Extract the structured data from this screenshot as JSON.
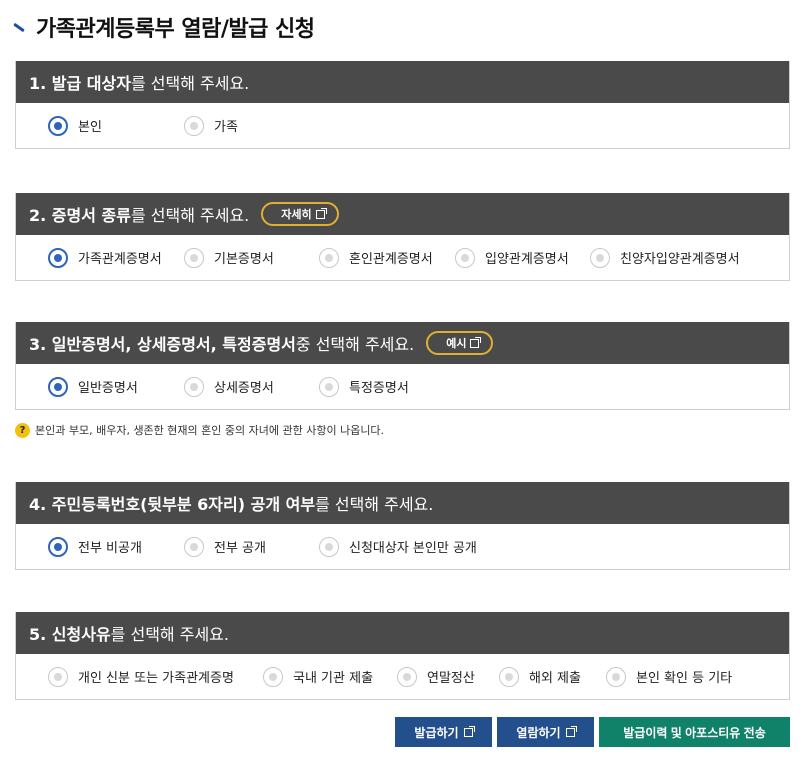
{
  "page": {
    "title": "가족관계등록부 열람/발급 신청"
  },
  "sections": [
    {
      "head_strong": "1. 발급 대상자",
      "head_rest": "를 선택해 주세요.",
      "options": [
        {
          "label": "본인",
          "checked": true
        },
        {
          "label": "가족",
          "checked": false
        }
      ]
    },
    {
      "head_strong": "2. 증명서 종류",
      "head_rest": "를 선택해 주세요.",
      "pill": "자세히",
      "options": [
        {
          "label": "가족관계증명서",
          "checked": true
        },
        {
          "label": "기본증명서",
          "checked": false
        },
        {
          "label": "혼인관계증명서",
          "checked": false
        },
        {
          "label": "입양관계증명서",
          "checked": false
        },
        {
          "label": "친양자입양관계증명서",
          "checked": false
        }
      ]
    },
    {
      "head_strong": "3. 일반증명서, 상세증명서, 특정증명서",
      "head_rest": " 중 선택해 주세요.",
      "pill": "예시",
      "options": [
        {
          "label": "일반증명서",
          "checked": true
        },
        {
          "label": "상세증명서",
          "checked": false
        },
        {
          "label": "특정증명서",
          "checked": false
        }
      ]
    },
    {
      "head_strong": "4. 주민등록번호(뒷부분 6자리) 공개 여부",
      "head_rest": "를 선택해 주세요.",
      "options": [
        {
          "label": "전부 비공개",
          "checked": true
        },
        {
          "label": "전부 공개",
          "checked": false
        },
        {
          "label": "신청대상자 본인만 공개",
          "checked": false
        }
      ]
    },
    {
      "head_strong": "5. 신청사유",
      "head_rest": "를 선택해 주세요.",
      "options": [
        {
          "label": "개인 신분 또는 가족관계증명",
          "checked": false
        },
        {
          "label": "국내 기관 제출",
          "checked": false
        },
        {
          "label": "연말정산",
          "checked": false
        },
        {
          "label": "해외 제출",
          "checked": false
        },
        {
          "label": "본인 확인 등 기타",
          "checked": false
        }
      ]
    }
  ],
  "note": {
    "icon": "?",
    "text": "본인과 부모, 배우자, 생존한 현재의 혼인 중의 자녀에 관한 사항이 나옵니다."
  },
  "buttons": {
    "issue": "발급하기",
    "view": "열람하기",
    "transmit": "발급이력 및 아포스티유 전송"
  },
  "colors": {
    "header_bg": "#4a4a4a",
    "radio_checked": "#2f64b8",
    "pill_border": "#e0b030",
    "button_blue": "#244f8d",
    "button_green": "#11826a"
  }
}
